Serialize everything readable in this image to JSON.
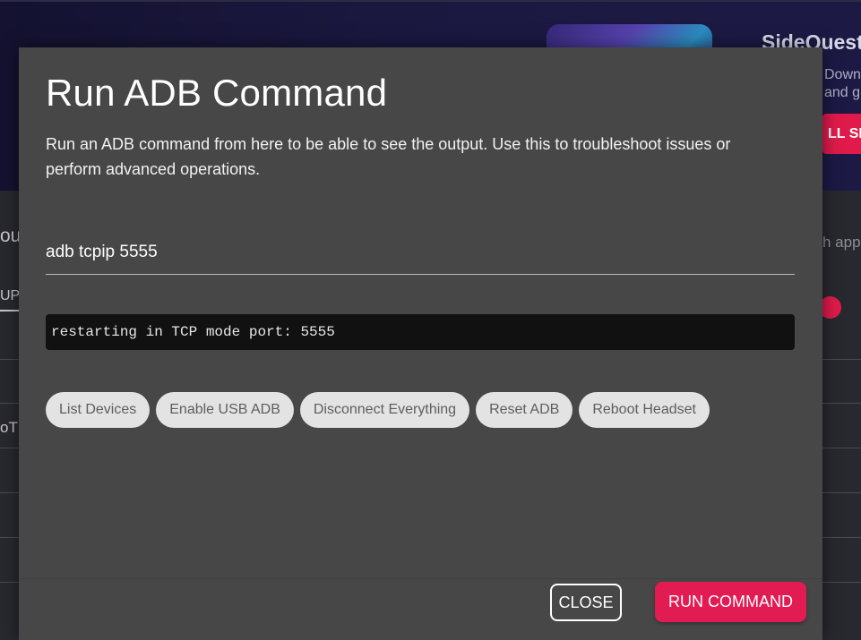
{
  "background": {
    "app_title": "SideQuest",
    "description_lines": [
      "Down",
      "and g"
    ],
    "install_button": "LL SID",
    "left_label": "ou",
    "left_tab": "UP",
    "left_row": "oT",
    "search_placeholder": "h app",
    "accent_color": "#e01b4c"
  },
  "dialog": {
    "title": "Run ADB Command",
    "description": "Run an ADB command from here to be able to see the output. Use this to troubleshoot issues or perform advanced operations.",
    "command_value": "adb tcpip 5555",
    "output_text": "restarting in TCP mode port: 5555",
    "quick_actions": [
      {
        "label": "List Devices"
      },
      {
        "label": "Enable USB ADB"
      },
      {
        "label": "Disconnect Everything"
      },
      {
        "label": "Reset ADB"
      },
      {
        "label": "Reboot Headset"
      }
    ],
    "close_label": "CLOSE",
    "run_label": "RUN COMMAND",
    "run_color": "#e21b53"
  }
}
